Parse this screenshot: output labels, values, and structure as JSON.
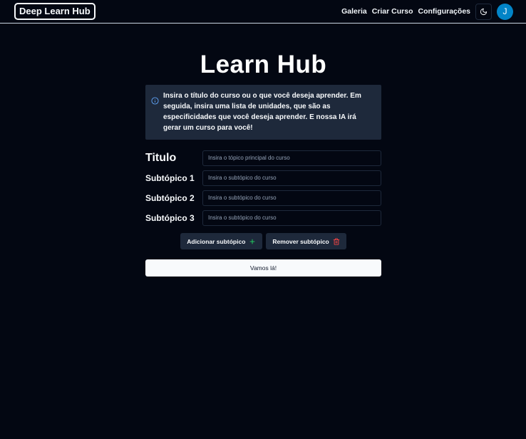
{
  "header": {
    "logo": "Deep Learn Hub",
    "nav": [
      "Galeria",
      "Criar Curso",
      "Configurações"
    ],
    "theme_icon": "moon-icon",
    "avatar_initial": "J"
  },
  "main": {
    "title": "Learn Hub",
    "info_text": "Insira o título do curso ou o que você deseja aprender. Em seguida, insira uma lista de unidades, que são as especificidades que você deseja aprender. E nossa IA irá gerar um curso para você!",
    "fields": [
      {
        "label": "Titulo",
        "placeholder": "Insira o tópico principal do curso"
      },
      {
        "label": "Subtópico 1",
        "placeholder": "Insira o subtópico do curso"
      },
      {
        "label": "Subtópico 2",
        "placeholder": "Insira o subtópico do curso"
      },
      {
        "label": "Subtópico 3",
        "placeholder": "Insira o subtópico do curso"
      }
    ],
    "add_button": "Adicionar subtópico",
    "remove_button": "Remover subtópico",
    "submit_button": "Vamos lá!"
  },
  "colors": {
    "background": "#030712",
    "panel": "#1e293b",
    "accent": "#0284c7",
    "add_icon": "#22c55e",
    "remove_icon": "#ef4444"
  }
}
